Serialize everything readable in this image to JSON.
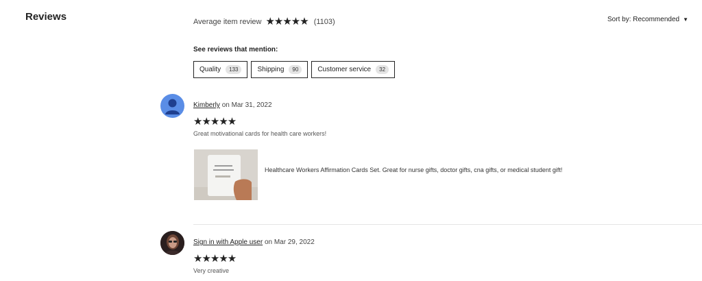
{
  "header": {
    "title": "Reviews",
    "average_label": "Average item review",
    "average_stars": "★★★★★",
    "review_count": "(1103)",
    "sort_label": "Sort by: Recommended",
    "sort_caret": "▼"
  },
  "mentions": {
    "label": "See reviews that mention:",
    "chips": [
      {
        "label": "Quality",
        "count": "133"
      },
      {
        "label": "Shipping",
        "count": "90"
      },
      {
        "label": "Customer service",
        "count": "32"
      }
    ]
  },
  "reviews": [
    {
      "name": "Kimberly",
      "date": "on Mar 31, 2022",
      "stars": "★★★★★",
      "text": "Great motivational cards for health care workers!",
      "item": "Healthcare Workers Affirmation Cards Set. Great for nurse gifts, doctor gifts, cna gifts, or medical student gift!",
      "avatar_icon": "default-user-icon"
    },
    {
      "name": "Sign in with Apple user",
      "date": "on Mar 29, 2022",
      "stars": "★★★★★",
      "text": "Very creative",
      "avatar_icon": "user-photo"
    }
  ],
  "colors": {
    "text": "#222222",
    "muted": "#555555",
    "avatar_default": "#5a8de6",
    "chip_count_bg": "#e4e4e4"
  }
}
